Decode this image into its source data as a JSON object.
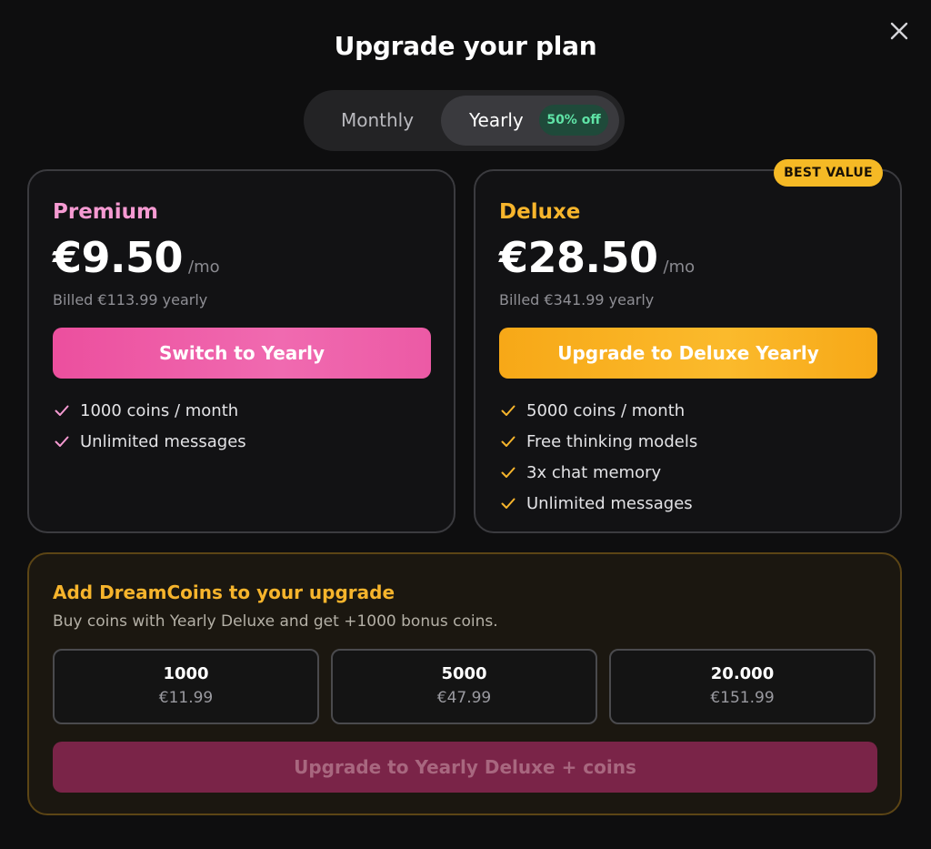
{
  "modal": {
    "title": "Upgrade your plan"
  },
  "billing_toggle": {
    "monthly_label": "Monthly",
    "yearly_label": "Yearly",
    "discount_badge": "50% off",
    "selected": "Yearly"
  },
  "plans": [
    {
      "name": "Premium",
      "price": "€9.50",
      "period": "/mo",
      "billed": "Billed €113.99 yearly",
      "cta": "Switch to Yearly",
      "accent": "#f59ad2",
      "features": [
        "1000 coins / month",
        "Unlimited messages"
      ]
    },
    {
      "name": "Deluxe",
      "badge": "BEST VALUE",
      "price": "€28.50",
      "period": "/mo",
      "billed": "Billed €341.99 yearly",
      "cta": "Upgrade to Deluxe Yearly",
      "accent": "#f7b52c",
      "features": [
        "5000 coins / month",
        "Free thinking models",
        "3x chat memory",
        "Unlimited messages"
      ]
    }
  ],
  "coins": {
    "title": "Add DreamCoins to your upgrade",
    "subtitle": "Buy coins with Yearly Deluxe and get +1000 bonus coins.",
    "options": [
      {
        "amount": "1000",
        "price": "€11.99"
      },
      {
        "amount": "5000",
        "price": "€47.99"
      },
      {
        "amount": "20.000",
        "price": "€151.99"
      }
    ],
    "cta": "Upgrade to Yearly Deluxe + coins"
  },
  "colors": {
    "background": "#0e0e0f",
    "premium_accent": "#ec4f9e",
    "deluxe_accent": "#f7a817",
    "discount_green": "#5fe3a6"
  }
}
